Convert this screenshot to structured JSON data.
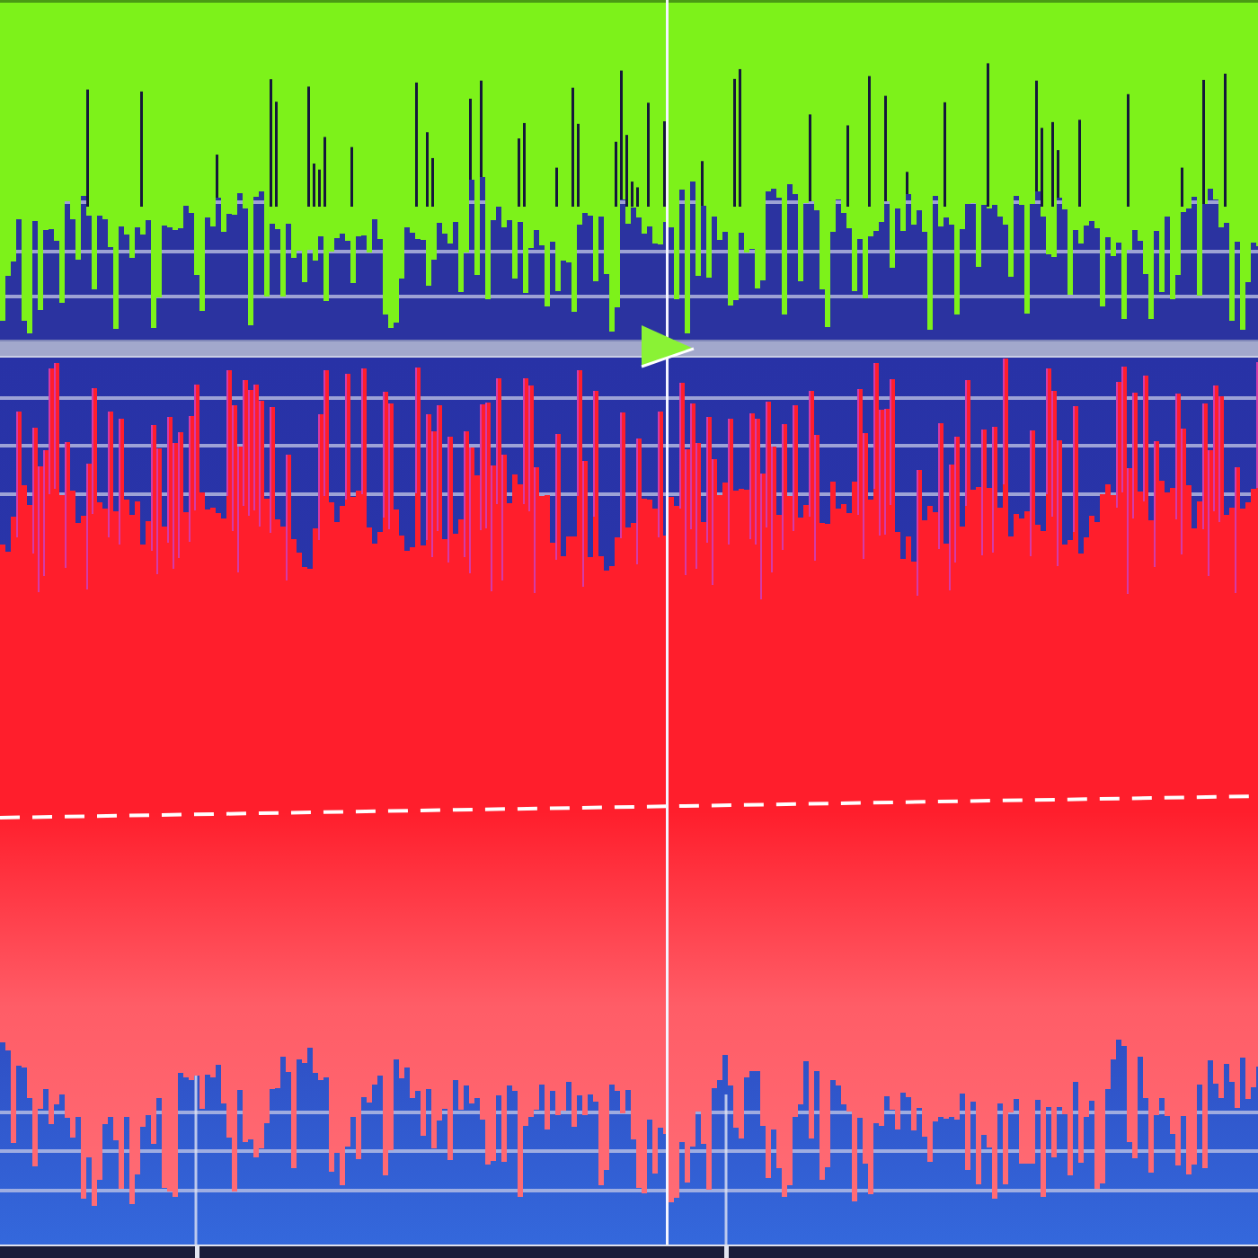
{
  "tracks": [
    {
      "color": "#7df21a"
    },
    {
      "color": "#ff1e2c"
    }
  ]
}
